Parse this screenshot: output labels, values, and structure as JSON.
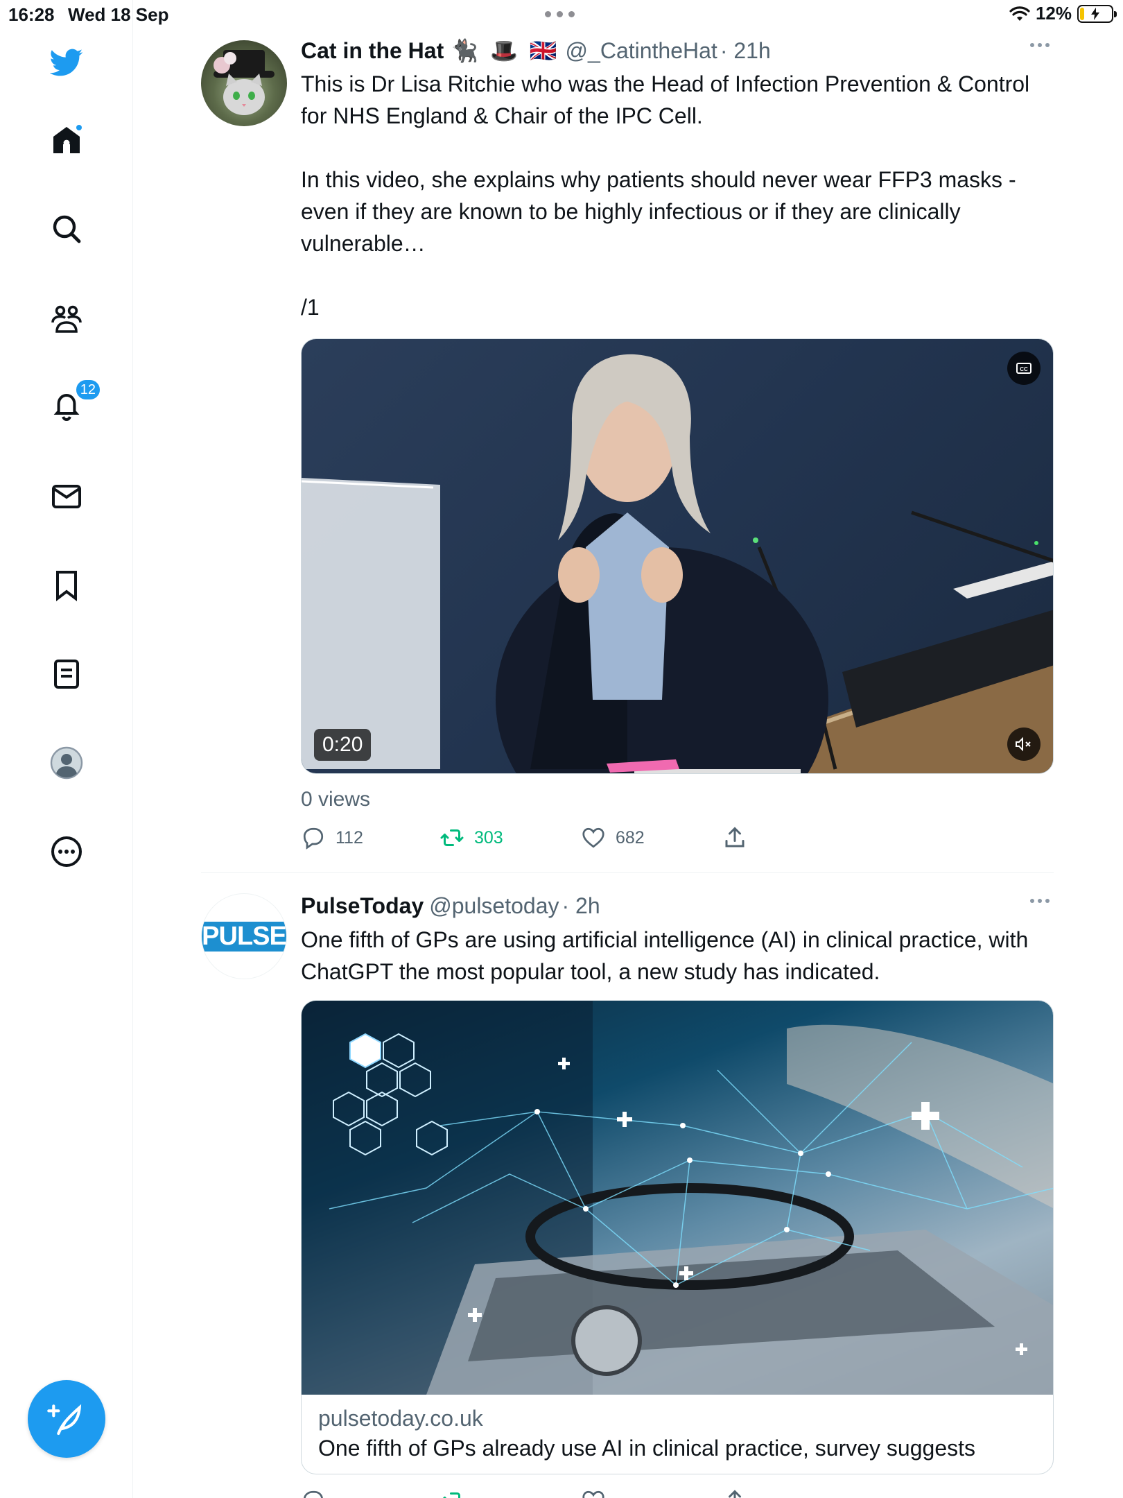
{
  "status_bar": {
    "time": "16:28",
    "date": "Wed 18 Sep",
    "battery": "12%",
    "battery_level": 0.12
  },
  "sidebar": {
    "items": [
      {
        "name": "twitter-logo",
        "icon": "bird-icon"
      },
      {
        "name": "home",
        "icon": "home-icon",
        "has_dot": true
      },
      {
        "name": "explore",
        "icon": "search-icon"
      },
      {
        "name": "communities",
        "icon": "people-icon"
      },
      {
        "name": "notifications",
        "icon": "bell-icon",
        "badge": "12"
      },
      {
        "name": "messages",
        "icon": "mail-icon"
      },
      {
        "name": "bookmarks",
        "icon": "bookmark-icon"
      },
      {
        "name": "lists",
        "icon": "list-icon"
      },
      {
        "name": "profile",
        "icon": "avatar-icon"
      },
      {
        "name": "more",
        "icon": "ellipsis-circle-icon"
      }
    ],
    "compose": "compose-tweet-icon"
  },
  "tweets": [
    {
      "name": "Cat in the Hat",
      "emoji": "🐈‍⬛ 🎩 🇬🇧",
      "handle": "@_CatintheHat",
      "time": "· 21h",
      "text": "This is Dr Lisa Ritchie who was the Head of Infection Prevention & Control for NHS England & Chair of the IPC Cell.\n\nIn this video, she explains why patients should never wear FFP3 masks - even if they are known to be highly infectious or if they are clinically vulnerable…\n\n/1",
      "video_duration": "0:20",
      "views": "0 views",
      "replies": "112",
      "retweets": "303",
      "likes": "682"
    },
    {
      "name": "PulseToday",
      "handle": "@pulsetoday",
      "time": "· 2h",
      "avatar_text": "PULSE",
      "text": "One fifth of GPs are using artificial intelligence (AI) in clinical practice, with ChatGPT the most popular tool, a new study has indicated.",
      "card_domain": "pulsetoday.co.uk",
      "card_title": "One fifth of GPs already use AI in clinical practice, survey suggests"
    }
  ],
  "colors": {
    "brand": "#1d9bf0",
    "retweet": "#00ba7c",
    "secondary_text": "#536471"
  }
}
